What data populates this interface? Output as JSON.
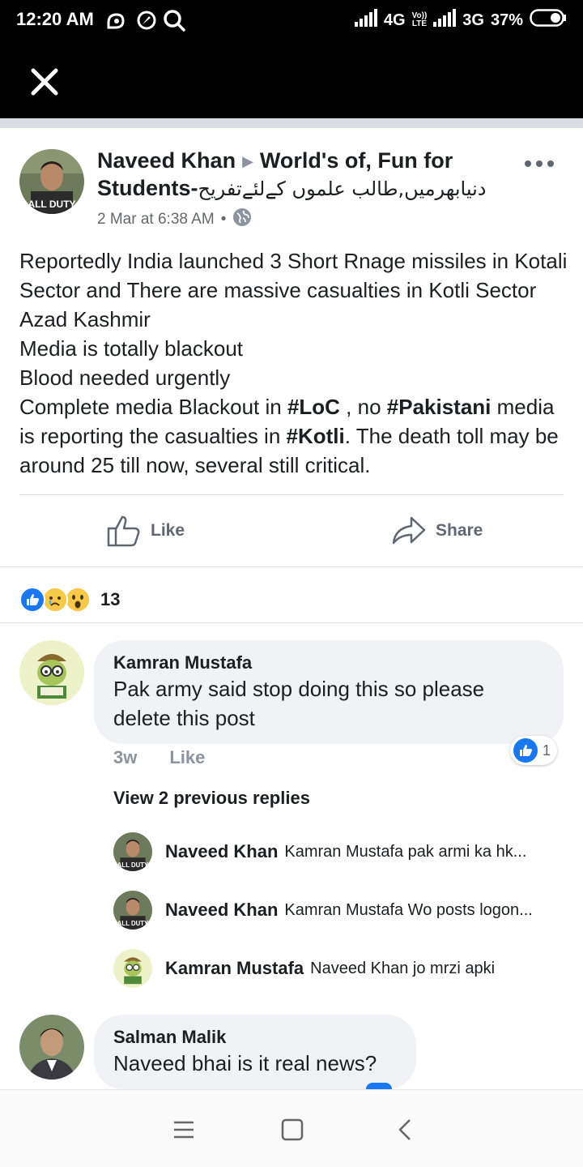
{
  "status_bar": {
    "time": "12:20 AM",
    "network_1": "4G",
    "volte_top": "Vo))",
    "volte_bottom": "LTE",
    "network_2": "3G",
    "battery": "37%"
  },
  "post": {
    "author": "Naveed Khan",
    "group_name": "World's of, Fun for Students-",
    "group_name_urdu": "دنیابھرمیں,طالب علموں کےلئےتفریح",
    "timestamp": "2 Mar at 6:38 AM",
    "separator": "•",
    "body": {
      "line1": "Reportedly India launched 3 Short Rnage missiles in Kotali Sector and There are massive casualties in Kotli Sector Azad Kashmir",
      "line2": "Media is totally blackout",
      "line3": "Blood needed urgently",
      "line4_a": "Complete media Blackout in ",
      "hashtag_loc": "#LoC",
      "line4_b": " , no ",
      "hashtag_pakistani": "#Pakistani",
      "line4_c": " media is reporting the casualties in ",
      "hashtag_kotli": "#Kotli",
      "line4_d": ". The death toll may be around 25 till now, several still critical."
    },
    "like_label": "Like",
    "share_label": "Share",
    "reaction_count": "13"
  },
  "comments": {
    "c1": {
      "name": "Kamran Mustafa",
      "text": "Pak army said stop doing this so please delete this post",
      "time": "3w",
      "like_label": "Like",
      "like_count": "1"
    },
    "view_replies": "View 2 previous replies",
    "replies": [
      {
        "name": "Naveed Khan",
        "text": "Kamran Mustafa pak armi ka hk..."
      },
      {
        "name": "Naveed Khan",
        "text": "Kamran Mustafa Wo posts logon..."
      },
      {
        "name": "Kamran Mustafa",
        "text": "Naveed Khan jo mrzi apki"
      }
    ],
    "c2": {
      "name": "Salman Malik",
      "text": "Naveed bhai is it real news?"
    }
  },
  "colors": {
    "facebook_blue": "#1877f2",
    "text_primary": "#1c1e21",
    "text_secondary": "#65676b",
    "bubble_bg": "#f0f2f5"
  }
}
